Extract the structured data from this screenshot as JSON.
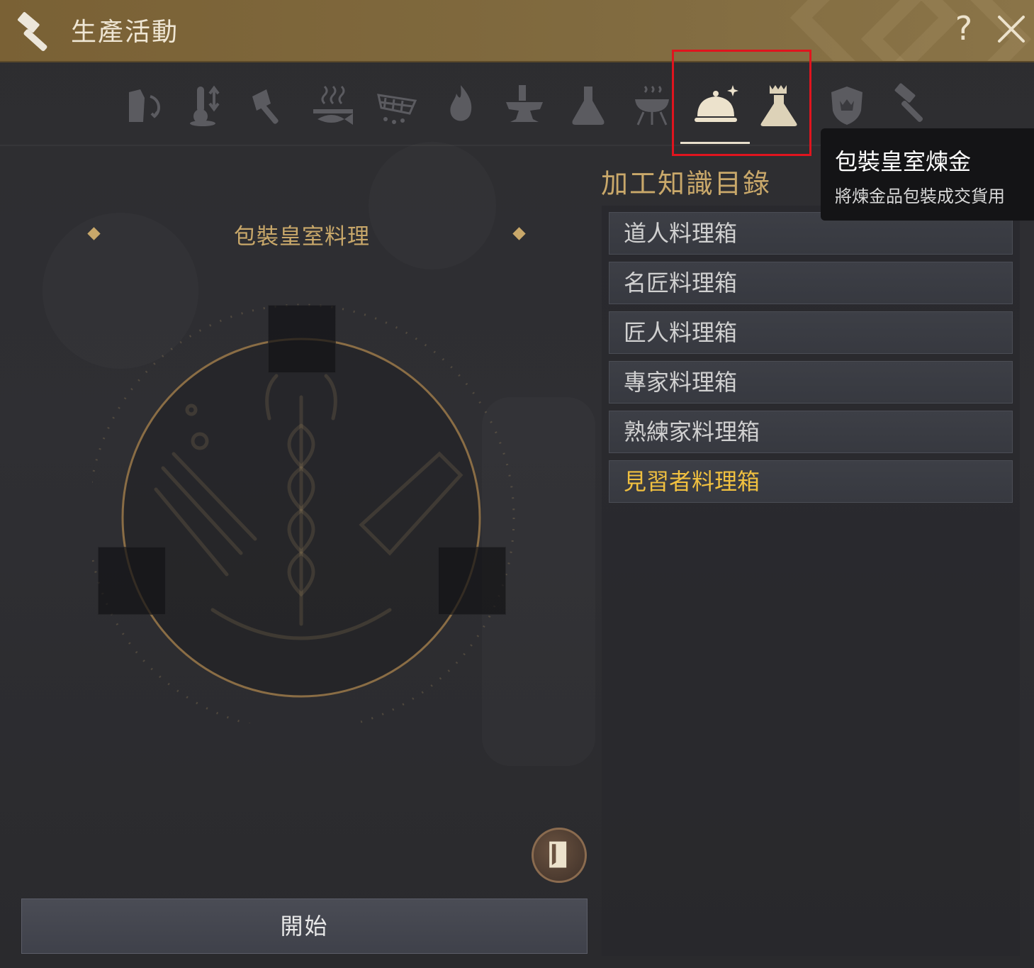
{
  "window": {
    "title": "生產活動",
    "help_label": "?"
  },
  "tabs": [
    {
      "icon": "gathering-icon"
    },
    {
      "icon": "thermometer-icon"
    },
    {
      "icon": "axe-icon"
    },
    {
      "icon": "fishing-icon"
    },
    {
      "icon": "net-icon"
    },
    {
      "icon": "fire-icon"
    },
    {
      "icon": "anvil-icon"
    },
    {
      "icon": "alchemy-flask-icon"
    },
    {
      "icon": "grill-icon"
    },
    {
      "icon": "cloche-icon",
      "active": true
    },
    {
      "icon": "royal-alchemy-icon"
    },
    {
      "icon": "shield-icon"
    },
    {
      "icon": "hammer-icon"
    }
  ],
  "tooltip": {
    "title": "包裝皇室煉金",
    "description": "將煉金品包裝成交貨用"
  },
  "left_panel": {
    "title": "包裝皇室料理",
    "start_button": "開始"
  },
  "catalog": {
    "title": "加工知識目錄",
    "items": [
      {
        "label": "道人料理箱"
      },
      {
        "label": "名匠料理箱"
      },
      {
        "label": "匠人料理箱"
      },
      {
        "label": "專家料理箱"
      },
      {
        "label": "熟練家料理箱"
      },
      {
        "label": "見習者料理箱",
        "selected": true
      }
    ]
  },
  "colors": {
    "accent_gold": "#c9a86a",
    "selected_text": "#f0c040",
    "highlight_box": "#e0141e",
    "title_bar": "#806a3f"
  }
}
